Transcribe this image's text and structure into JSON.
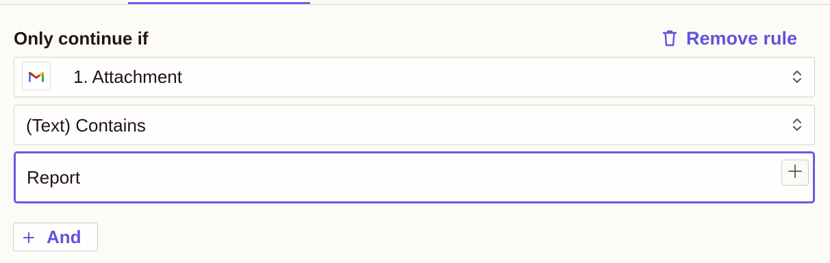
{
  "filter": {
    "heading": "Only continue if",
    "remove_rule_label": "Remove rule",
    "trigger_field": {
      "app_icon": "gmail-icon",
      "value": "1. Attachment"
    },
    "operator_field": {
      "value": "(Text) Contains"
    },
    "value_field": {
      "value": "Report"
    },
    "and_button_label": "And"
  },
  "colors": {
    "accent": "#6054d9",
    "focus_border": "#6759e3",
    "background": "#fcfbf8",
    "text": "#201515"
  }
}
